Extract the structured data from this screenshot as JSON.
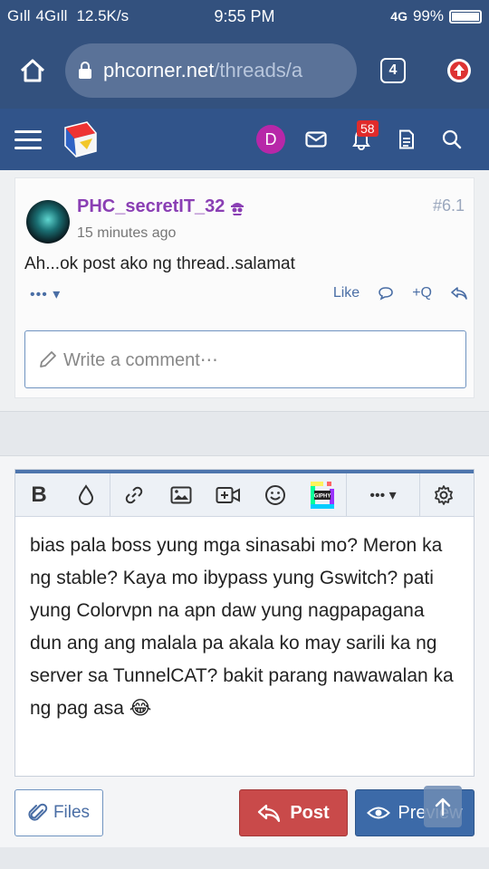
{
  "status_bar": {
    "signal_1": "Gıll",
    "signal_2": "4Gıll",
    "speed": "12.5K/s",
    "time": "9:55 PM",
    "network": "4G",
    "battery_text": "99%",
    "battery_level": 0.99
  },
  "browser": {
    "url_domain": "phcorner.net",
    "url_path": "/threads/a",
    "tab_count": "4"
  },
  "site_header": {
    "avatar_letter": "D",
    "notification_count": "58"
  },
  "comment": {
    "username": "PHC_secretIT_32",
    "time_ago": "15 minutes ago",
    "post_number": "#6.1",
    "body": "Ah...ok post ako ng thread..salamat",
    "more_label": "••• ▾",
    "like_label": "Like",
    "quote_label": "+Q",
    "write_placeholder": "Write a comment⋯"
  },
  "editor": {
    "text": "bias pala boss yung mga sinasabi mo? Meron ka ng stable? Kaya mo ibypass yung Gswitch? pati yung Colorvpn na apn daw yung nagpapagana dun ang ang malala pa akala ko may sarili ka ng server sa TunnelCAT? bakit parang nawawalan ka ng pag asa 😂",
    "bold_label": "B",
    "more_label": "••• ▾",
    "giphy_label": "GIPHY"
  },
  "actions": {
    "files_label": "Files",
    "post_label": "Post",
    "preview_label": "Preview"
  },
  "colors": {
    "header_bg": "#31548a",
    "status_bg": "#33517e",
    "username": "#8a3fb4",
    "post_button": "#c94a4a",
    "preview_button": "#3c6aa8"
  }
}
